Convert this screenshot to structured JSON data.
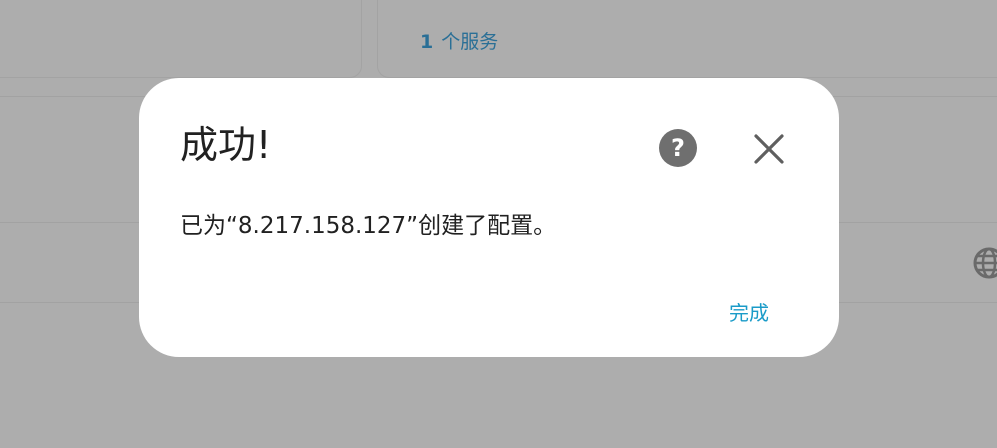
{
  "background": {
    "services_count": "1",
    "services_label": "个服务"
  },
  "dialog": {
    "title": "成功!",
    "help_icon": "help-circle-icon",
    "close_icon": "close-icon",
    "message": "已为“8.217.158.127”创建了配置。",
    "done_label": "完成"
  },
  "colors": {
    "overlay": "#adadad",
    "dialog_bg": "#ffffff",
    "accent": "#1a9bc8",
    "link": "#2a6f96",
    "icon_gray": "#6f6f6f"
  }
}
